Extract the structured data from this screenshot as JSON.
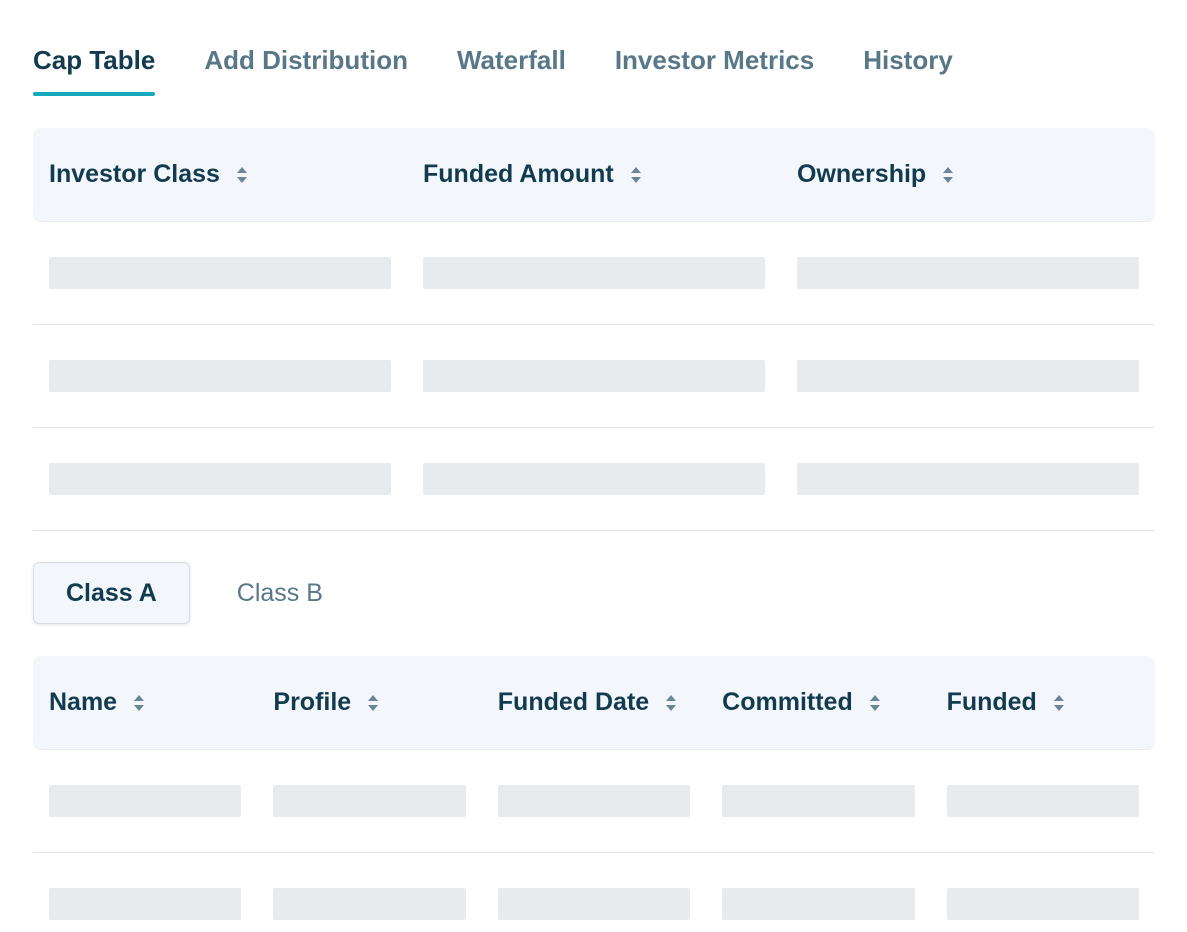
{
  "tabs": [
    {
      "label": "Cap Table",
      "active": true
    },
    {
      "label": "Add Distribution",
      "active": false
    },
    {
      "label": "Waterfall",
      "active": false
    },
    {
      "label": "Investor Metrics",
      "active": false
    },
    {
      "label": "History",
      "active": false
    }
  ],
  "cap_table": {
    "columns": [
      "Investor Class",
      "Funded Amount",
      "Ownership"
    ],
    "loading_rows": 3
  },
  "class_tabs": [
    {
      "label": "Class A",
      "active": true
    },
    {
      "label": "Class B",
      "active": false
    }
  ],
  "investor_table": {
    "columns": [
      "Name",
      "Profile",
      "Funded Date",
      "Committed",
      "Funded"
    ],
    "loading_rows": 2
  },
  "colors": {
    "accent": "#16a8bc",
    "header_bg": "#f3f6fa",
    "skeleton": "#e8ebee",
    "text_dark": "#123b4f",
    "text_muted": "#587787"
  },
  "icons": {
    "sort": "sort-up-down-icon"
  }
}
